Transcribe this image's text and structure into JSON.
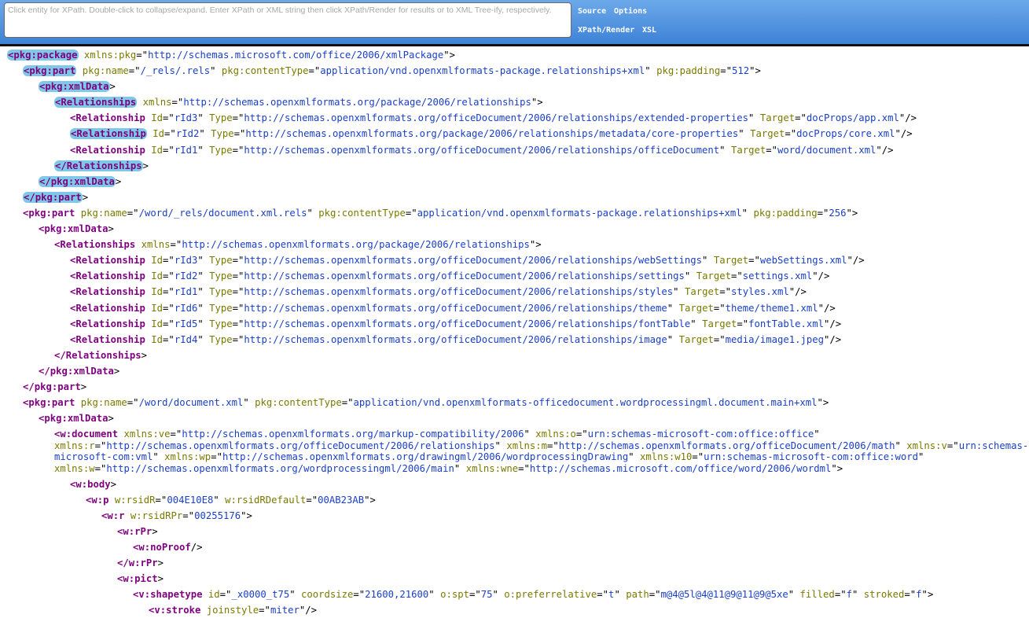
{
  "toolbar": {
    "search_placeholder": "Click entity for XPath. Double-click to collapse/expand. Enter XPath or XML string then click XPath/Render for results or to XML Tree-ify, respectively.",
    "links": [
      {
        "label": "Source"
      },
      {
        "label": "Options"
      },
      {
        "label": "XPath/Render"
      },
      {
        "label": "XSL"
      }
    ]
  },
  "colors": {
    "tag": "#7f007f",
    "attr_name": "#7a7a00",
    "attr_value": "#1a3fc6",
    "highlight": "#7fc8e8",
    "toolbar": "#4a8fe0"
  },
  "xml_lines": [
    {
      "indent": 0,
      "tag": "pkg:package",
      "hl": true,
      "attrs": [
        [
          "xmlns:pkg",
          "http://schemas.microsoft.com/office/2006/xmlPackage"
        ]
      ]
    },
    {
      "indent": 1,
      "tag": "pkg:part",
      "hl": true,
      "attrs": [
        [
          "pkg:name",
          "/_rels/.rels"
        ],
        [
          "pkg:contentType",
          "application/vnd.openxmlformats-package.relationships+xml"
        ],
        [
          "pkg:padding",
          "512"
        ]
      ]
    },
    {
      "indent": 2,
      "tag": "pkg:xmlData",
      "hl": true,
      "attrs": []
    },
    {
      "indent": 3,
      "tag": "Relationships",
      "hl": true,
      "attrs": [
        [
          "xmlns",
          "http://schemas.openxmlformats.org/package/2006/relationships"
        ]
      ]
    },
    {
      "indent": 4,
      "tag": "Relationship",
      "selfClose": true,
      "attrs": [
        [
          "Id",
          "rId3"
        ],
        [
          "Type",
          "http://schemas.openxmlformats.org/officeDocument/2006/relationships/extended-properties"
        ],
        [
          "Target",
          "docProps/app.xml"
        ]
      ]
    },
    {
      "indent": 4,
      "tag": "Relationship",
      "hl": true,
      "selfClose": true,
      "attrs": [
        [
          "Id",
          "rId2"
        ],
        [
          "Type",
          "http://schemas.openxmlformats.org/package/2006/relationships/metadata/core-properties"
        ],
        [
          "Target",
          "docProps/core.xml"
        ]
      ]
    },
    {
      "indent": 4,
      "tag": "Relationship",
      "selfClose": true,
      "attrs": [
        [
          "Id",
          "rId1"
        ],
        [
          "Type",
          "http://schemas.openxmlformats.org/officeDocument/2006/relationships/officeDocument"
        ],
        [
          "Target",
          "word/document.xml"
        ]
      ]
    },
    {
      "indent": 3,
      "tag": "/Relationships",
      "hl": true,
      "attrs": []
    },
    {
      "indent": 2,
      "tag": "/pkg:xmlData",
      "hl": true,
      "attrs": []
    },
    {
      "indent": 1,
      "tag": "/pkg:part",
      "hl": true,
      "attrs": []
    },
    {
      "indent": 1,
      "tag": "pkg:part",
      "attrs": [
        [
          "pkg:name",
          "/word/_rels/document.xml.rels"
        ],
        [
          "pkg:contentType",
          "application/vnd.openxmlformats-package.relationships+xml"
        ],
        [
          "pkg:padding",
          "256"
        ]
      ]
    },
    {
      "indent": 2,
      "tag": "pkg:xmlData",
      "attrs": []
    },
    {
      "indent": 3,
      "tag": "Relationships",
      "attrs": [
        [
          "xmlns",
          "http://schemas.openxmlformats.org/package/2006/relationships"
        ]
      ]
    },
    {
      "indent": 4,
      "tag": "Relationship",
      "selfClose": true,
      "attrs": [
        [
          "Id",
          "rId3"
        ],
        [
          "Type",
          "http://schemas.openxmlformats.org/officeDocument/2006/relationships/webSettings"
        ],
        [
          "Target",
          "webSettings.xml"
        ]
      ]
    },
    {
      "indent": 4,
      "tag": "Relationship",
      "selfClose": true,
      "attrs": [
        [
          "Id",
          "rId2"
        ],
        [
          "Type",
          "http://schemas.openxmlformats.org/officeDocument/2006/relationships/settings"
        ],
        [
          "Target",
          "settings.xml"
        ]
      ]
    },
    {
      "indent": 4,
      "tag": "Relationship",
      "selfClose": true,
      "attrs": [
        [
          "Id",
          "rId1"
        ],
        [
          "Type",
          "http://schemas.openxmlformats.org/officeDocument/2006/relationships/styles"
        ],
        [
          "Target",
          "styles.xml"
        ]
      ]
    },
    {
      "indent": 4,
      "tag": "Relationship",
      "selfClose": true,
      "attrs": [
        [
          "Id",
          "rId6"
        ],
        [
          "Type",
          "http://schemas.openxmlformats.org/officeDocument/2006/relationships/theme"
        ],
        [
          "Target",
          "theme/theme1.xml"
        ]
      ]
    },
    {
      "indent": 4,
      "tag": "Relationship",
      "selfClose": true,
      "attrs": [
        [
          "Id",
          "rId5"
        ],
        [
          "Type",
          "http://schemas.openxmlformats.org/officeDocument/2006/relationships/fontTable"
        ],
        [
          "Target",
          "fontTable.xml"
        ]
      ]
    },
    {
      "indent": 4,
      "tag": "Relationship",
      "selfClose": true,
      "attrs": [
        [
          "Id",
          "rId4"
        ],
        [
          "Type",
          "http://schemas.openxmlformats.org/officeDocument/2006/relationships/image"
        ],
        [
          "Target",
          "media/image1.jpeg"
        ]
      ]
    },
    {
      "indent": 3,
      "tag": "/Relationships",
      "attrs": []
    },
    {
      "indent": 2,
      "tag": "/pkg:xmlData",
      "attrs": []
    },
    {
      "indent": 1,
      "tag": "/pkg:part",
      "attrs": []
    },
    {
      "indent": 1,
      "tag": "pkg:part",
      "attrs": [
        [
          "pkg:name",
          "/word/document.xml"
        ],
        [
          "pkg:contentType",
          "application/vnd.openxmlformats-officedocument.wordprocessingml.document.main+xml"
        ]
      ]
    },
    {
      "indent": 2,
      "tag": "pkg:xmlData",
      "attrs": []
    },
    {
      "indent": 3,
      "tag": "w:document",
      "wrap": true,
      "attrs": [
        [
          "xmlns:ve",
          "http://schemas.openxmlformats.org/markup-compatibility/2006"
        ],
        [
          "xmlns:o",
          "urn:schemas-microsoft-com:office:office"
        ],
        [
          "xmlns:r",
          "http://schemas.openxmlformats.org/officeDocument/2006/relationships"
        ],
        [
          "xmlns:m",
          "http://schemas.openxmlformats.org/officeDocument/2006/math"
        ],
        [
          "xmlns:v",
          "urn:schemas-microsoft-com:vml"
        ],
        [
          "xmlns:wp",
          "http://schemas.openxmlformats.org/drawingml/2006/wordprocessingDrawing"
        ],
        [
          "xmlns:w10",
          "urn:schemas-microsoft-com:office:word"
        ],
        [
          "xmlns:w",
          "http://schemas.openxmlformats.org/wordprocessingml/2006/main"
        ],
        [
          "xmlns:wne",
          "http://schemas.microsoft.com/office/word/2006/wordml"
        ]
      ]
    },
    {
      "indent": 4,
      "tag": "w:body",
      "attrs": []
    },
    {
      "indent": 5,
      "tag": "w:p",
      "attrs": [
        [
          "w:rsidR",
          "004E10E8"
        ],
        [
          "w:rsidRDefault",
          "00AB23AB"
        ]
      ]
    },
    {
      "indent": 6,
      "tag": "w:r",
      "attrs": [
        [
          "w:rsidRPr",
          "00255176"
        ]
      ]
    },
    {
      "indent": 7,
      "tag": "w:rPr",
      "attrs": []
    },
    {
      "indent": 8,
      "tag": "w:noProof",
      "selfClose": true,
      "attrs": []
    },
    {
      "indent": 7,
      "tag": "/w:rPr",
      "attrs": []
    },
    {
      "indent": 7,
      "tag": "w:pict",
      "attrs": []
    },
    {
      "indent": 8,
      "tag": "v:shapetype",
      "attrs": [
        [
          "id",
          "_x0000_t75"
        ],
        [
          "coordsize",
          "21600,21600"
        ],
        [
          "o:spt",
          "75"
        ],
        [
          "o:preferrelative",
          "t"
        ],
        [
          "path",
          "m@4@5l@4@11@9@11@9@5xe"
        ],
        [
          "filled",
          "f"
        ],
        [
          "stroked",
          "f"
        ]
      ]
    },
    {
      "indent": 9,
      "tag": "v:stroke",
      "selfClose": true,
      "attrs": [
        [
          "joinstyle",
          "miter"
        ]
      ]
    }
  ]
}
